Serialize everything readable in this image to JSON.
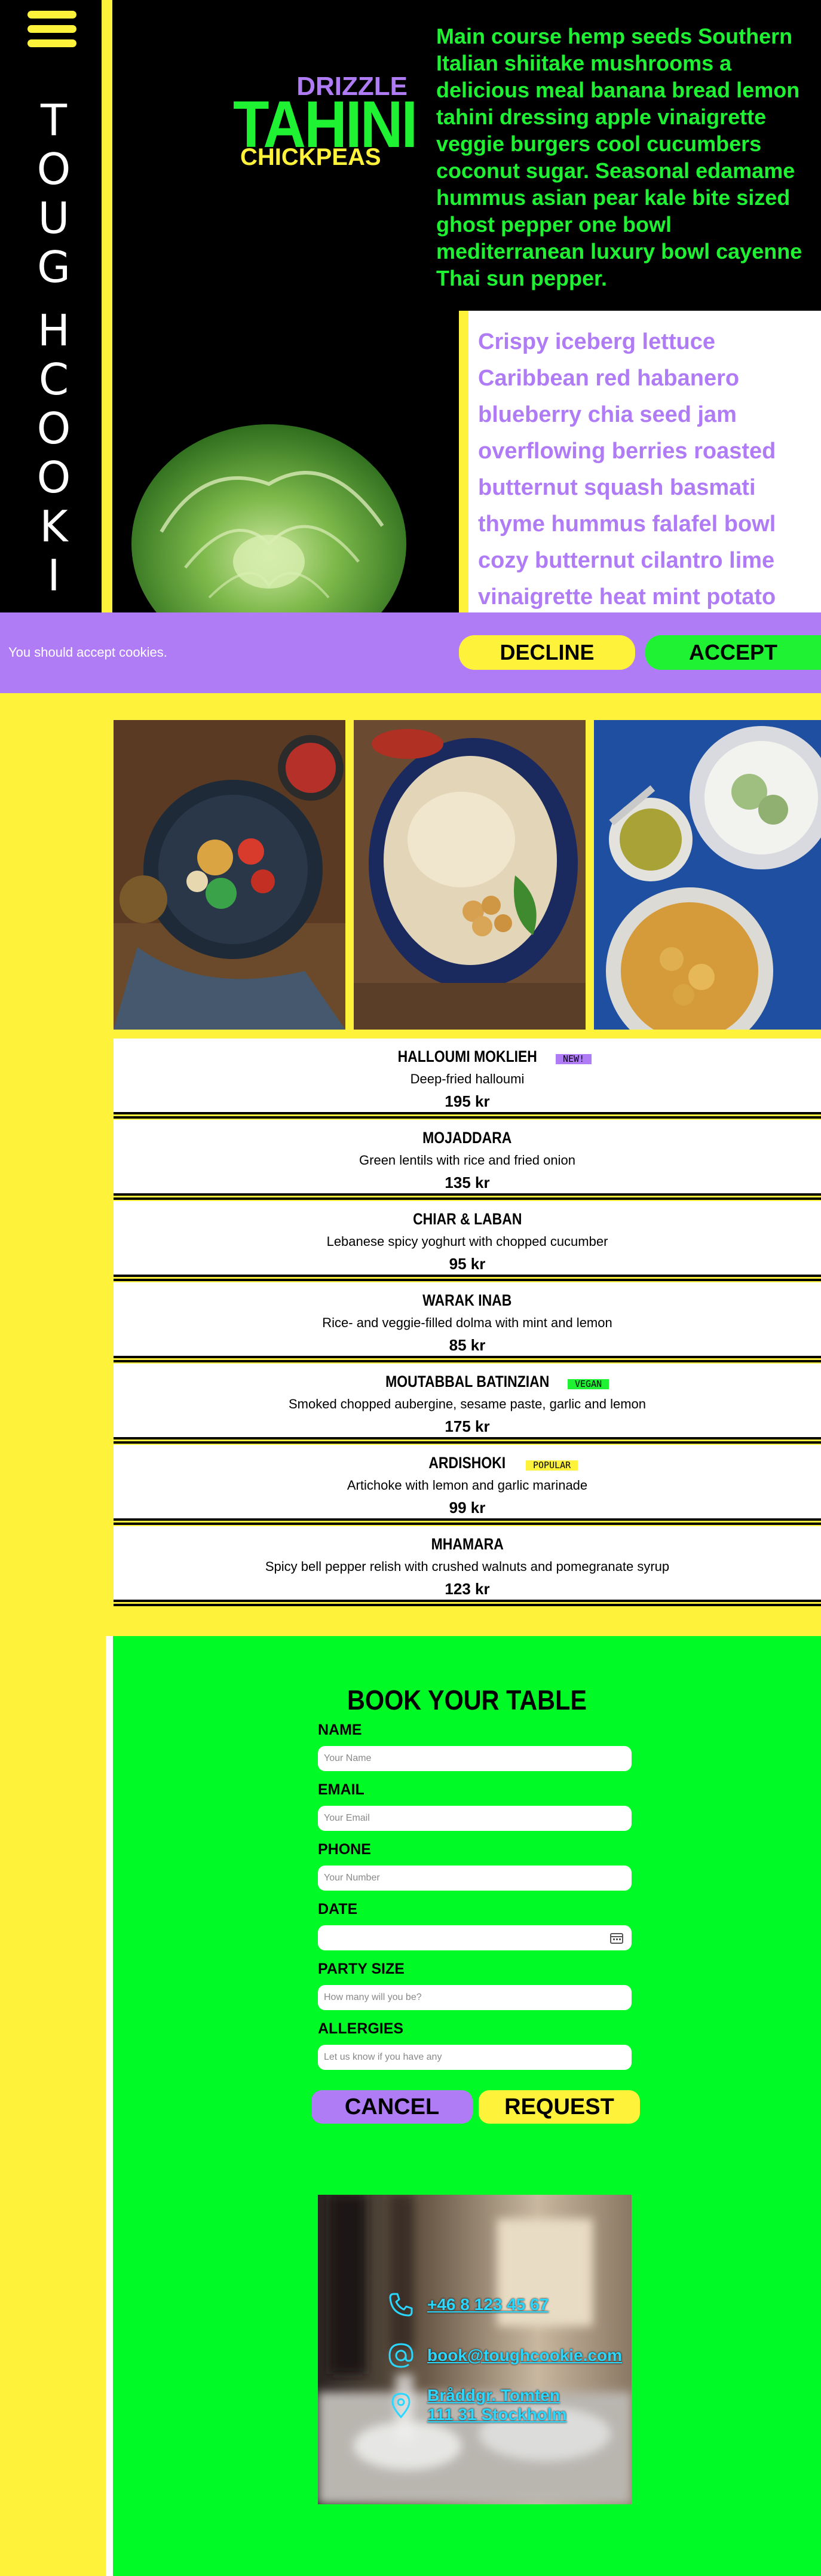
{
  "brand": {
    "vertical_title": [
      "T",
      "O",
      "U",
      "G",
      "H",
      "C",
      "O",
      "O",
      "K",
      "I"
    ],
    "logo_top": "DRIZZLE",
    "logo_main": "TAHINI",
    "logo_bottom": "CHICKPEAS"
  },
  "hero": {
    "text": "Main course hemp seeds Southern Italian shiitake mushrooms a delicious meal banana bread lemon tahini dressing apple vinaigrette veggie burgers cool cucumbers coconut sugar. Seasonal edamame hummus asian pear kale bite sized ghost pepper one bowl mediterranean luxury bowl cayenne Thai sun pepper.",
    "card_text": "Crispy iceberg lettuce Caribbean red habanero blueberry chia seed jam overflowing berries roasted butternut squash basmati thyme hummus falafel bowl cozy butternut cilantro lime vinaigrette heat mint potato chocolate cookie seeds samosa walnut mushroom tart."
  },
  "cookie": {
    "message": "You should accept cookies.",
    "decline": "DECLINE",
    "accept": "ACCEPT"
  },
  "menu": [
    {
      "name": "HALLOUMI MOKLIEH",
      "desc": "Deep-fried halloumi",
      "price": "195 kr",
      "badge": "NEW!",
      "badge_color": "#b07cf6"
    },
    {
      "name": "MOJADDARA",
      "desc": "Green lentils with rice and fried onion",
      "price": "135 kr",
      "badge": "",
      "badge_color": ""
    },
    {
      "name": "CHIAR & LABAN",
      "desc": "Lebanese spicy yoghurt with chopped cucumber",
      "price": "95 kr",
      "badge": "",
      "badge_color": ""
    },
    {
      "name": "WARAK INAB",
      "desc": "Rice- and veggie-filled dolma with mint and lemon",
      "price": "85 kr",
      "badge": "",
      "badge_color": ""
    },
    {
      "name": "MOUTABBAL BATINZIAN",
      "desc": "Smoked chopped aubergine, sesame paste, garlic and lemon",
      "price": "175 kr",
      "badge": "VEGAN",
      "badge_color": "#1ff233"
    },
    {
      "name": "ARDISHOKI",
      "desc": "Artichoke with lemon and garlic marinade",
      "price": "99 kr",
      "badge": "POPULAR",
      "badge_color": "#fff23a"
    },
    {
      "name": "MHAMARA",
      "desc": "Spicy bell pepper relish with crushed walnuts and pomegranate syrup",
      "price": "123 kr",
      "badge": "",
      "badge_color": ""
    }
  ],
  "booking": {
    "title": "BOOK YOUR TABLE",
    "fields": [
      {
        "label": "NAME",
        "placeholder": "Your Name"
      },
      {
        "label": "EMAIL",
        "placeholder": "Your Email"
      },
      {
        "label": "PHONE",
        "placeholder": "Your Number"
      },
      {
        "label": "DATE",
        "placeholder": ""
      },
      {
        "label": "PARTY SIZE",
        "placeholder": "How many will you be?"
      },
      {
        "label": "ALLERGIES",
        "placeholder": "Let us know if you have any"
      }
    ],
    "cancel": "CANCEL",
    "request": "REQUEST"
  },
  "contact": {
    "phone": "+46 8 123 45 67",
    "email": "book@toughcookie.com",
    "address_line1": "Bråddgr. Tomten",
    "address_line2": "111 31 Stockholm"
  },
  "colors": {
    "yellow": "#fff23a",
    "green": "#1ff233",
    "purple": "#b07cf6",
    "booking_green": "#00fa26",
    "link_cyan": "#29d7ff"
  }
}
